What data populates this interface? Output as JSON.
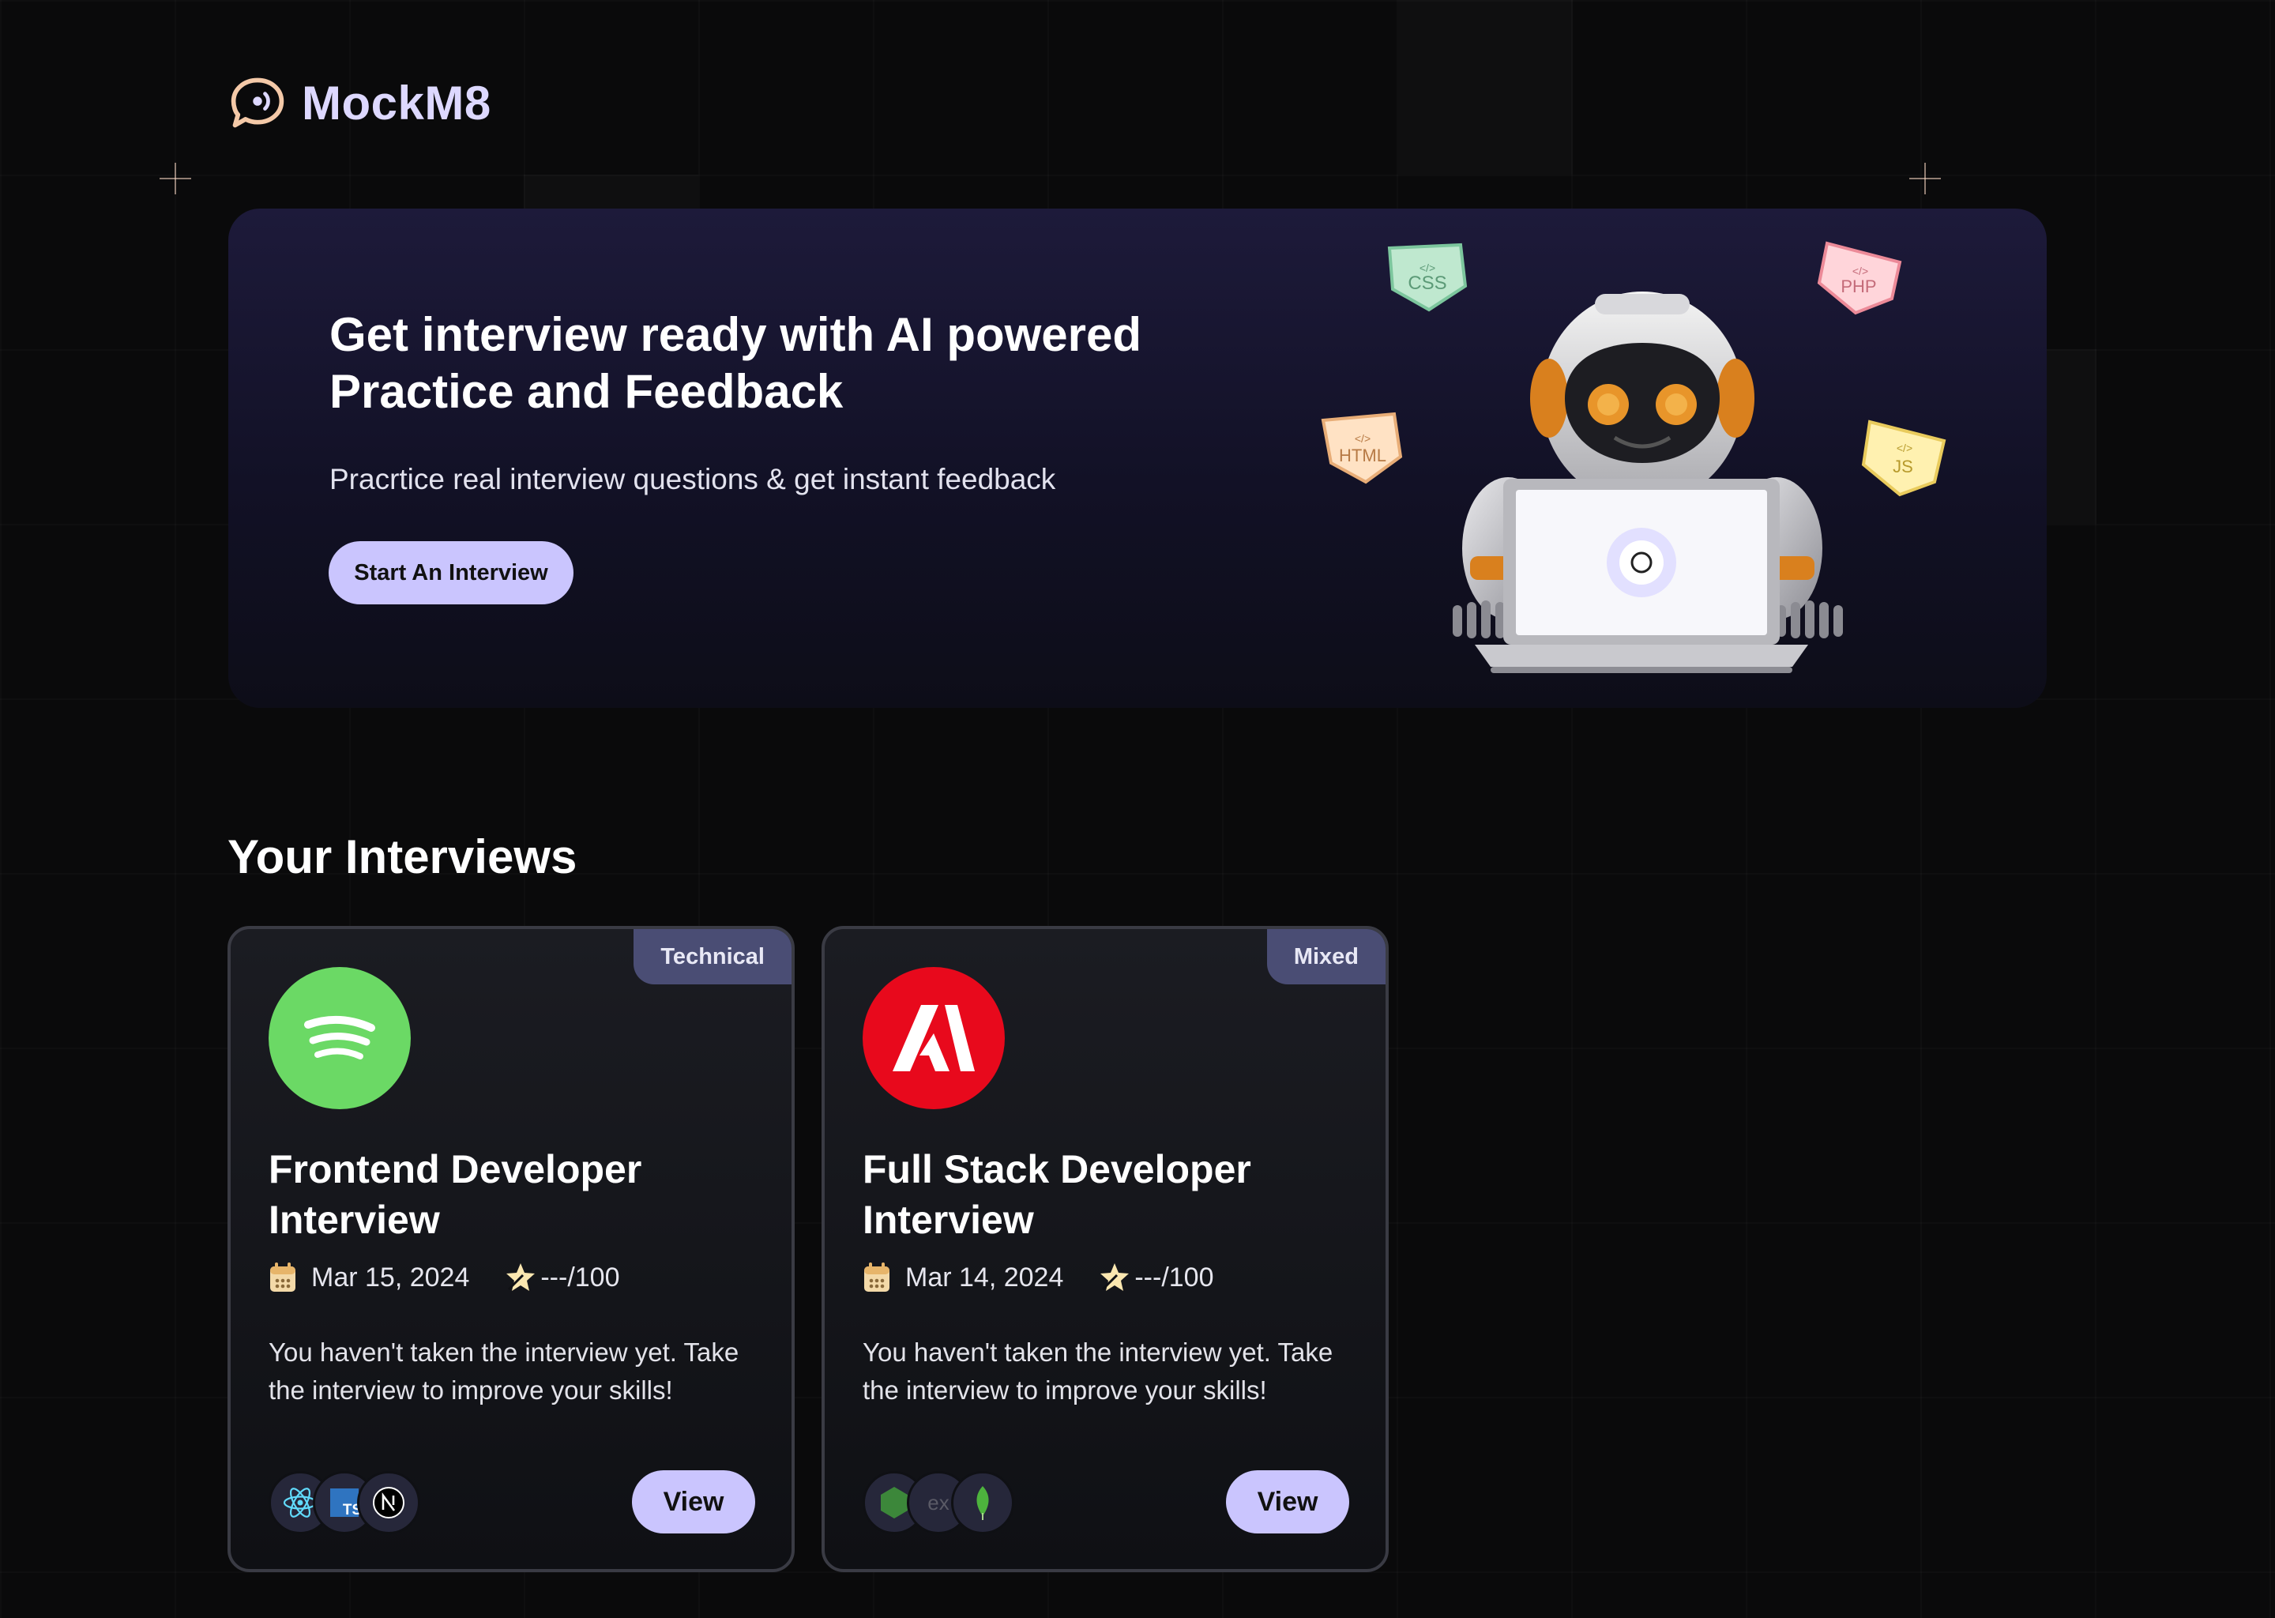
{
  "brand": {
    "name": "MockM8",
    "logo_icon": "chat-bubble-icon"
  },
  "hero": {
    "title": "Get interview ready with AI powered Practice and Feedback",
    "subtitle": "Pracrtice real interview questions & get instant feedback",
    "cta_label": "Start An Interview",
    "badges": [
      "CSS",
      "PHP",
      "HTML",
      "JS"
    ]
  },
  "section": {
    "title": "Your Interviews"
  },
  "interviews": [
    {
      "badge": "Technical",
      "company_logo": "spotify-logo",
      "title": "Frontend Developer Interview",
      "date": "Mar 15, 2024",
      "score": "---/100",
      "description": "You haven't taken the interview yet. Take the interview to improve your skills!",
      "tech_stack": [
        "react-icon",
        "typescript-icon",
        "nextjs-icon"
      ],
      "view_label": "View"
    },
    {
      "badge": "Mixed",
      "company_logo": "adobe-logo",
      "title": "Full Stack Developer Interview",
      "date": "Mar 14, 2024",
      "score": "---/100",
      "description": "You haven't taken the interview yet. Take the interview to improve your skills!",
      "tech_stack": [
        "nodejs-icon",
        "express-icon",
        "mongodb-icon"
      ],
      "view_label": "View"
    }
  ],
  "colors": {
    "accent": "#cac5fe",
    "badge_bg": "#4a4d74",
    "spotify_green": "#6bd965",
    "adobe_red": "#e8091c",
    "hero_bg": "#1d1a3a"
  }
}
